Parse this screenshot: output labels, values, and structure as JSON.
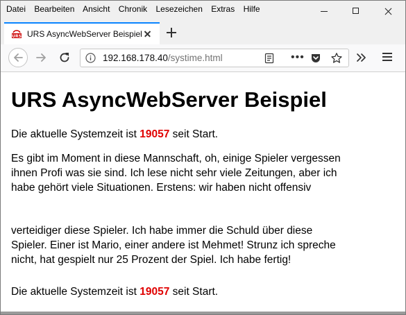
{
  "menu": {
    "items": [
      "Datei",
      "Bearbeiten",
      "Ansicht",
      "Chronik",
      "Lesezeichen",
      "Extras",
      "Hilfe"
    ]
  },
  "tab": {
    "title": "URS AsyncWebServer Beispiel",
    "favicon_text": "URS"
  },
  "navbar": {
    "url_host": "192.168.178.40",
    "url_path": "/systime.html",
    "more_label": "•••"
  },
  "page": {
    "heading": "URS AsyncWebServer Beispiel",
    "time_prefix": "Die aktuelle Systemzeit ist ",
    "time_value": "19057",
    "time_suffix": " seit Start.",
    "paragraph_lines_top": [
      "Es gibt im Moment in diese Mannschaft, oh, einige Spieler vergessen",
      "ihnen Profi was sie sind. Ich lese nicht sehr viele Zeitungen, aber ich",
      "habe gehört viele Situationen. Erstens: wir haben nicht offensiv"
    ],
    "paragraph_lines_bottom": [
      "verteidiger diese Spieler. Ich habe immer die Schuld über diese",
      "Spieler. Einer ist Mario, einer andere ist Mehmet! Strunz ich spreche",
      "nicht, hat gespielt nur 25 Prozent der Spiel. Ich habe fertig!"
    ],
    "time_prefix_2": "Die aktuelle Systemzeit ist ",
    "time_value_2": "19057",
    "time_suffix_2": " seit Start."
  },
  "colors": {
    "accent_tab": "#0a84ff",
    "highlight_number": "#e00000"
  }
}
